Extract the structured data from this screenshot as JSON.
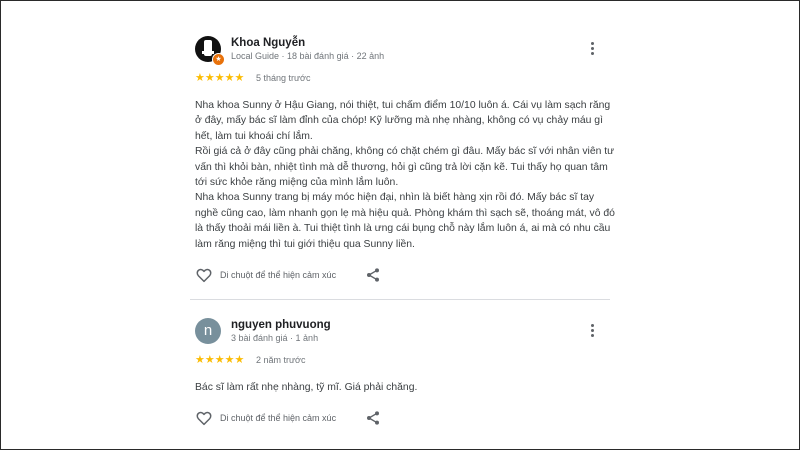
{
  "reviews": [
    {
      "name": "Khoa Nguyễn",
      "meta": "Local Guide · 18 bài đánh giá · 22 ảnh",
      "stars": "★★★★★",
      "rating": 5,
      "when": "5 tháng trước",
      "paragraphs": [
        "Nha khoa Sunny ở Hậu Giang, nói thiệt, tui chấm điểm 10/10 luôn á. Cái vụ làm sạch răng ở đây, mấy bác sĩ làm đỉnh của chóp! Kỹ lưỡng mà nhẹ nhàng, không có vụ chảy máu gì hết, làm tui khoái chí lắm.",
        "Rồi giá cả ở đây cũng phải chăng, không có chặt chém gì đâu. Mấy bác sĩ với nhân viên tư vấn thì khỏi bàn, nhiệt tình mà dễ thương, hỏi gì cũng trả lời cặn kẽ. Tui thấy họ quan tâm tới sức khỏe răng miệng của mình lắm luôn.",
        "Nha khoa Sunny trang bị máy móc hiện đại, nhìn là biết hàng xịn rồi đó. Mấy bác sĩ tay nghề cũng cao, làm nhanh gọn lẹ mà hiệu quả. Phòng khám thì sạch sẽ, thoáng mát, vô đó là thấy thoải mái liền à. Tui thiệt tình là ưng cái bụng chỗ này lắm luôn á, ai mà có nhu cầu làm răng miệng thì tui giới thiệu qua Sunny liền."
      ],
      "like_label": "Di chuột để thể hiện cảm xúc",
      "avatar_icon": "user-photo-icon",
      "badge_icon": "local-guide-badge-icon"
    },
    {
      "name": "nguyen phuvuong",
      "meta": "3 bài đánh giá · 1 ảnh",
      "avatar_letter": "n",
      "stars": "★★★★★",
      "rating": 5,
      "when": "2 năm trước",
      "paragraphs": [
        "Bác sĩ làm rất nhẹ nhàng, tỹ mĩ. Giá phải chăng."
      ],
      "like_label": "Di chuột để thể hiện cảm xúc"
    }
  ],
  "colors": {
    "star": "#fbbc04",
    "avatar_letter_bg": "#78909c",
    "badge": "#e8710a",
    "divider": "#dadce0"
  },
  "icons": {
    "more": "more-vert-icon",
    "like": "heart-outline-icon",
    "share": "share-icon"
  }
}
